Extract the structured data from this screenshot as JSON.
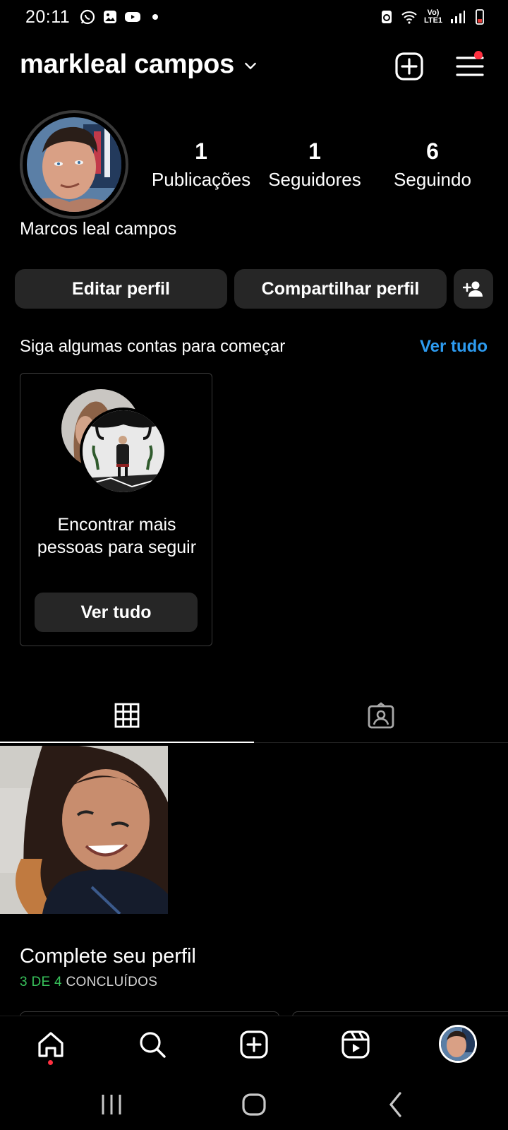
{
  "status_bar": {
    "time": "20:11",
    "network_label": "Vo) LTE1",
    "icons_left": [
      "whatsapp-icon",
      "gallery-icon",
      "youtube-icon",
      "dot-icon"
    ],
    "icons_right": [
      "recycle-icon",
      "wifi-icon",
      "volte-icon",
      "signal-icon",
      "battery-icon"
    ]
  },
  "header": {
    "username": "markleal campos",
    "has_notification_dot": true,
    "notification_color": "#ff3040"
  },
  "profile": {
    "full_name": "Marcos leal campos",
    "stats": [
      {
        "value": "1",
        "label": "Publicações"
      },
      {
        "value": "1",
        "label": "Seguidores"
      },
      {
        "value": "6",
        "label": "Seguindo"
      }
    ]
  },
  "actions": {
    "edit_label": "Editar perfil",
    "share_label": "Compartilhar perfil"
  },
  "suggestions": {
    "title": "Siga algumas contas para começar",
    "see_all": "Ver tudo",
    "card_text": "Encontrar mais pessoas para seguir",
    "card_button": "Ver tudo"
  },
  "tabs": [
    "grid-icon",
    "tagged-icon"
  ],
  "complete_profile": {
    "title": "Complete seu perfil",
    "progress_highlight": "3 DE 4",
    "progress_rest": "CONCLUÍDOS"
  },
  "bottom_nav": [
    "home-icon",
    "search-icon",
    "create-icon",
    "reels-icon",
    "profile-avatar"
  ],
  "colors": {
    "accent_link": "#2d9bf0",
    "button_bg": "#262626",
    "progress_green": "#38c25b"
  }
}
